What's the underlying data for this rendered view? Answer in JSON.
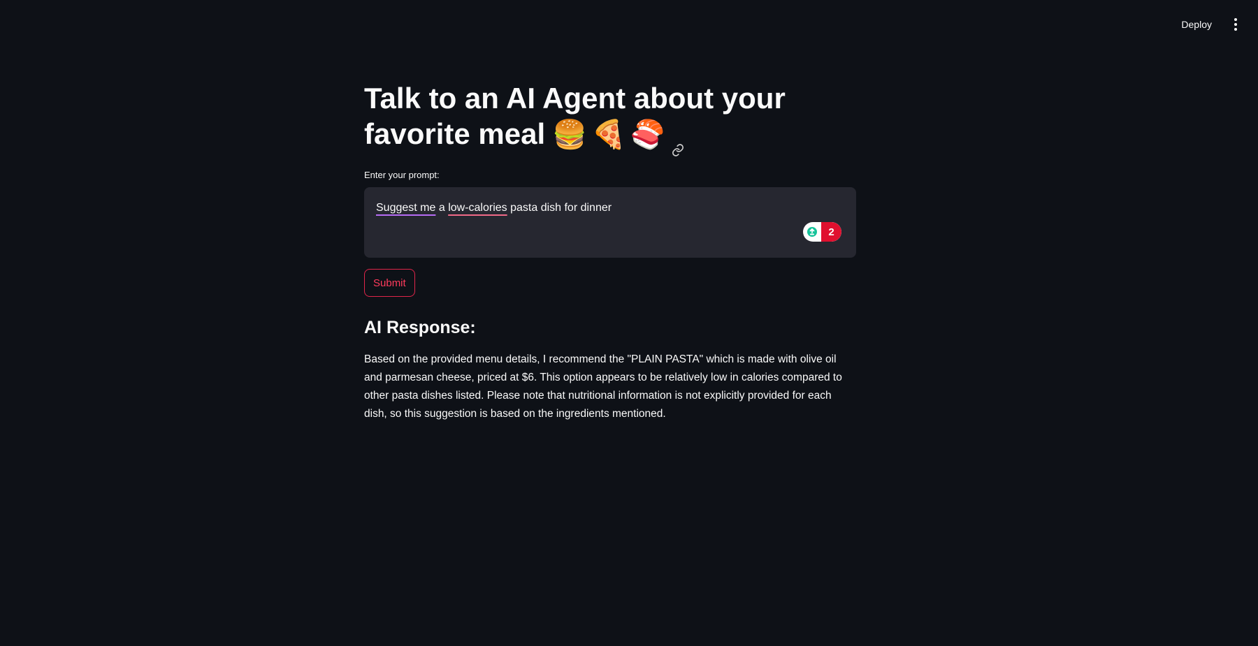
{
  "header": {
    "deploy_label": "Deploy",
    "menu_icon": "kebab-menu-icon"
  },
  "main": {
    "title": "Talk to an AI Agent about your favorite meal",
    "title_emojis": [
      "🍔",
      "🍕",
      "🍣"
    ],
    "anchor_icon": "link-icon",
    "prompt_label": "Enter your prompt:",
    "prompt_value": {
      "word1": "Suggest me",
      "word2": " a ",
      "word3": "low-calories",
      "word4": " pasta dish for dinner"
    },
    "grammar_badge": {
      "icon": "grammarly-icon",
      "count": "2"
    },
    "submit_label": "Submit",
    "response_heading": "AI Response:",
    "response_text": "Based on the provided menu details, I recommend the \"PLAIN PASTA\" which is made with olive oil and parmesan cheese, priced at $6. This option appears to be relatively low in calories compared to other pasta dishes listed. Please note that nutritional information is not explicitly provided for each dish, so this suggestion is based on the ingredients mentioned."
  },
  "colors": {
    "background": "#0e1117",
    "input_background": "#262730",
    "accent": "#ff4b4b"
  }
}
